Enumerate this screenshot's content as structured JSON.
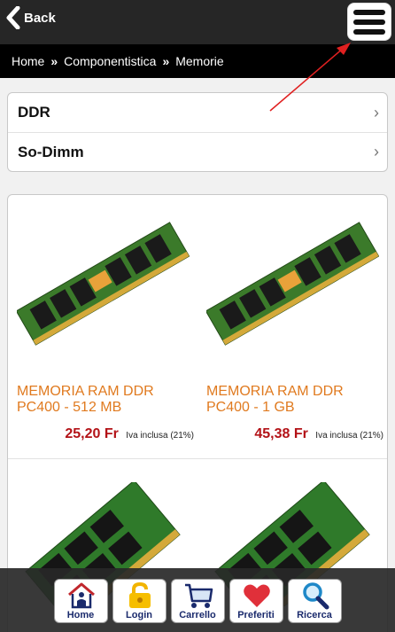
{
  "header": {
    "back_label": "Back",
    "menu_icon": "hamburger-menu-icon"
  },
  "breadcrumb": {
    "items": [
      "Home",
      "Componentistica",
      "Memorie"
    ],
    "separator": "»"
  },
  "categories": [
    {
      "label": "DDR",
      "icon": "chevron-right-icon"
    },
    {
      "label": "So-Dimm",
      "icon": "chevron-right-icon"
    }
  ],
  "products": [
    {
      "name": "MEMORIA RAM DDR PC400 - 512 MB",
      "price": "25,20 Fr",
      "vat": "Iva inclusa (21%)"
    },
    {
      "name": "MEMORIA RAM DDR PC400 - 1 GB",
      "price": "45,38 Fr",
      "vat": "Iva inclusa (21%)"
    },
    {
      "name": "",
      "price": "",
      "vat": ""
    },
    {
      "name": "",
      "price": "",
      "vat": ""
    }
  ],
  "bottom_nav": [
    {
      "label": "Home",
      "icon": "house-icon"
    },
    {
      "label": "Login",
      "icon": "padlock-icon"
    },
    {
      "label": "Carrello",
      "icon": "cart-icon"
    },
    {
      "label": "Preferiti",
      "icon": "heart-icon"
    },
    {
      "label": "Ricerca",
      "icon": "magnifier-icon"
    }
  ],
  "colors": {
    "header_bg": "#262626",
    "breadcrumb_bg": "#000000",
    "product_name": "#e07a1f",
    "price": "#b31217",
    "nav_label": "#1a2a6c",
    "annotation_arrow": "#e02020"
  }
}
